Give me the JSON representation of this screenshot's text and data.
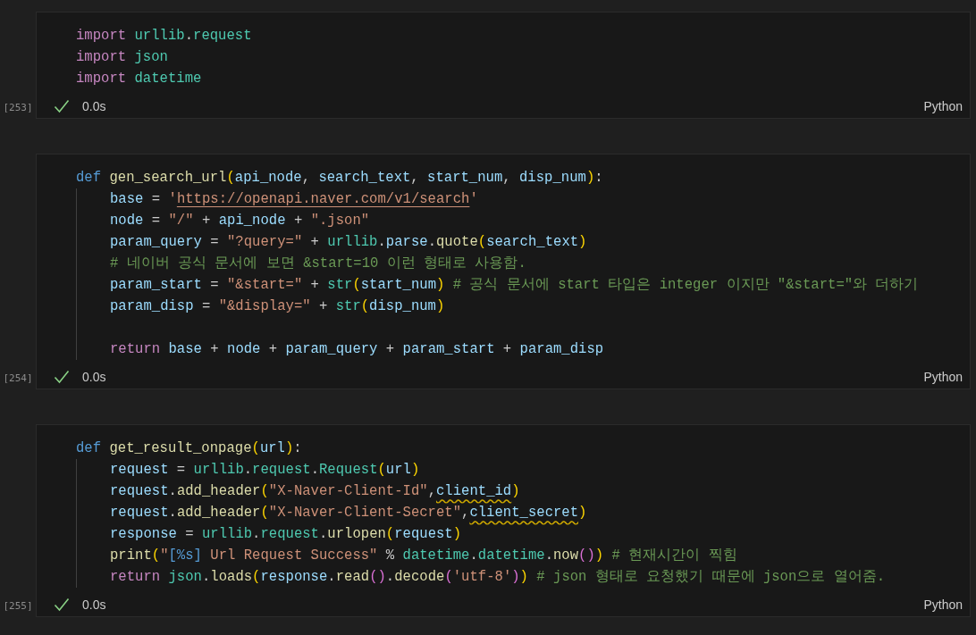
{
  "cells": [
    {
      "count": "[253]",
      "success": true,
      "duration": "0.0s",
      "language": "Python",
      "lines": [
        {
          "kind": "code",
          "tokens": [
            {
              "kind": "keyword",
              "text": "import"
            },
            {
              "kind": "module",
              "text": " urllib"
            },
            {
              "kind": "operator",
              "text": "."
            },
            {
              "kind": "module",
              "text": "request"
            }
          ]
        },
        {
          "kind": "code",
          "tokens": [
            {
              "kind": "keyword",
              "text": "import"
            },
            {
              "kind": "module",
              "text": " json"
            }
          ]
        },
        {
          "kind": "code",
          "tokens": [
            {
              "kind": "keyword",
              "text": "import"
            },
            {
              "kind": "module",
              "text": " datetime"
            }
          ]
        }
      ]
    },
    {
      "count": "[254]",
      "success": true,
      "duration": "0.0s",
      "language": "Python",
      "lines": [
        {
          "kind": "code",
          "tokens": [
            {
              "kind": "def",
              "text": "def"
            },
            {
              "kind": "function",
              "text": " gen_search_url"
            },
            {
              "kind": "bracket",
              "text": "("
            },
            {
              "kind": "variable",
              "text": "api_node"
            },
            {
              "kind": "operator",
              "text": ", "
            },
            {
              "kind": "variable",
              "text": "search_text"
            },
            {
              "kind": "operator",
              "text": ", "
            },
            {
              "kind": "variable",
              "text": "start_num"
            },
            {
              "kind": "operator",
              "text": ", "
            },
            {
              "kind": "variable",
              "text": "disp_num"
            },
            {
              "kind": "bracket",
              "text": ")"
            },
            {
              "kind": "operator",
              "text": ":"
            }
          ],
          "children": [
            {
              "kind": "code",
              "tokens": [
                {
                  "kind": "variable",
                  "text": "base"
                },
                {
                  "kind": "operator",
                  "text": " = "
                },
                {
                  "kind": "string",
                  "text": "'"
                },
                {
                  "kind": "link",
                  "text": "https://openapi.naver.com/v1/search"
                },
                {
                  "kind": "string",
                  "text": "'"
                }
              ]
            },
            {
              "kind": "code",
              "tokens": [
                {
                  "kind": "variable",
                  "text": "node"
                },
                {
                  "kind": "operator",
                  "text": " = "
                },
                {
                  "kind": "string",
                  "text": "\"/\""
                },
                {
                  "kind": "operator",
                  "text": " + "
                },
                {
                  "kind": "variable",
                  "text": "api_node"
                },
                {
                  "kind": "operator",
                  "text": " + "
                },
                {
                  "kind": "string",
                  "text": "\".json\""
                }
              ]
            },
            {
              "kind": "code",
              "tokens": [
                {
                  "kind": "variable",
                  "text": "param_query"
                },
                {
                  "kind": "operator",
                  "text": " = "
                },
                {
                  "kind": "string",
                  "text": "\"?query=\""
                },
                {
                  "kind": "operator",
                  "text": " + "
                },
                {
                  "kind": "module",
                  "text": "urllib"
                },
                {
                  "kind": "operator",
                  "text": "."
                },
                {
                  "kind": "variable",
                  "text": "parse"
                },
                {
                  "kind": "operator",
                  "text": "."
                },
                {
                  "kind": "function",
                  "text": "quote"
                },
                {
                  "kind": "bracket",
                  "text": "("
                },
                {
                  "kind": "variable",
                  "text": "search_text"
                },
                {
                  "kind": "bracket",
                  "text": ")"
                }
              ]
            },
            {
              "kind": "code",
              "tokens": [
                {
                  "kind": "comment",
                  "text": "# 네이버 공식 문서에 보면 &start=10 이런 형태로 사용함."
                }
              ]
            },
            {
              "kind": "code",
              "tokens": [
                {
                  "kind": "variable",
                  "text": "param_start"
                },
                {
                  "kind": "operator",
                  "text": " = "
                },
                {
                  "kind": "string",
                  "text": "\"&start=\""
                },
                {
                  "kind": "operator",
                  "text": " + "
                },
                {
                  "kind": "module",
                  "text": "str"
                },
                {
                  "kind": "bracket",
                  "text": "("
                },
                {
                  "kind": "variable",
                  "text": "start_num"
                },
                {
                  "kind": "bracket",
                  "text": ")"
                },
                {
                  "kind": "comment",
                  "text": " # 공식 문서에 start 타입은 integer 이지만 \"&start=\"와 더하기"
                }
              ]
            },
            {
              "kind": "code",
              "tokens": [
                {
                  "kind": "variable",
                  "text": "param_disp"
                },
                {
                  "kind": "operator",
                  "text": " = "
                },
                {
                  "kind": "string",
                  "text": "\"&display=\""
                },
                {
                  "kind": "operator",
                  "text": " + "
                },
                {
                  "kind": "module",
                  "text": "str"
                },
                {
                  "kind": "bracket",
                  "text": "("
                },
                {
                  "kind": "variable",
                  "text": "disp_num"
                },
                {
                  "kind": "bracket",
                  "text": ")"
                }
              ]
            },
            {
              "kind": "blank"
            },
            {
              "kind": "code",
              "tokens": [
                {
                  "kind": "keyword",
                  "text": "return"
                },
                {
                  "kind": "variable",
                  "text": " base"
                },
                {
                  "kind": "operator",
                  "text": " + "
                },
                {
                  "kind": "variable",
                  "text": "node"
                },
                {
                  "kind": "operator",
                  "text": " + "
                },
                {
                  "kind": "variable",
                  "text": "param_query"
                },
                {
                  "kind": "operator",
                  "text": " + "
                },
                {
                  "kind": "variable",
                  "text": "param_start"
                },
                {
                  "kind": "operator",
                  "text": " + "
                },
                {
                  "kind": "variable",
                  "text": "param_disp"
                }
              ]
            }
          ]
        }
      ]
    },
    {
      "count": "[255]",
      "success": true,
      "duration": "0.0s",
      "language": "Python",
      "lines": [
        {
          "kind": "code",
          "tokens": [
            {
              "kind": "def",
              "text": "def"
            },
            {
              "kind": "function",
              "text": " get_result_onpage"
            },
            {
              "kind": "bracket",
              "text": "("
            },
            {
              "kind": "variable",
              "text": "url"
            },
            {
              "kind": "bracket",
              "text": ")"
            },
            {
              "kind": "operator",
              "text": ":"
            }
          ],
          "children": [
            {
              "kind": "code",
              "tokens": [
                {
                  "kind": "variable",
                  "text": "request"
                },
                {
                  "kind": "operator",
                  "text": " = "
                },
                {
                  "kind": "module",
                  "text": "urllib"
                },
                {
                  "kind": "operator",
                  "text": "."
                },
                {
                  "kind": "module",
                  "text": "request"
                },
                {
                  "kind": "operator",
                  "text": "."
                },
                {
                  "kind": "module",
                  "text": "Request"
                },
                {
                  "kind": "bracket",
                  "text": "("
                },
                {
                  "kind": "variable",
                  "text": "url"
                },
                {
                  "kind": "bracket",
                  "text": ")"
                }
              ]
            },
            {
              "kind": "code",
              "tokens": [
                {
                  "kind": "variable",
                  "text": "request"
                },
                {
                  "kind": "operator",
                  "text": "."
                },
                {
                  "kind": "function",
                  "text": "add_header"
                },
                {
                  "kind": "bracket",
                  "text": "("
                },
                {
                  "kind": "string",
                  "text": "\"X-Naver-Client-Id\""
                },
                {
                  "kind": "operator",
                  "text": ","
                },
                {
                  "kind": "warning",
                  "text": "client_id"
                },
                {
                  "kind": "bracket",
                  "text": ")"
                }
              ]
            },
            {
              "kind": "code",
              "tokens": [
                {
                  "kind": "variable",
                  "text": "request"
                },
                {
                  "kind": "operator",
                  "text": "."
                },
                {
                  "kind": "function",
                  "text": "add_header"
                },
                {
                  "kind": "bracket",
                  "text": "("
                },
                {
                  "kind": "string",
                  "text": "\"X-Naver-Client-Secret\""
                },
                {
                  "kind": "operator",
                  "text": ","
                },
                {
                  "kind": "warning",
                  "text": "client_secret"
                },
                {
                  "kind": "bracket",
                  "text": ")"
                }
              ]
            },
            {
              "kind": "code",
              "tokens": [
                {
                  "kind": "variable",
                  "text": "response"
                },
                {
                  "kind": "operator",
                  "text": " = "
                },
                {
                  "kind": "module",
                  "text": "urllib"
                },
                {
                  "kind": "operator",
                  "text": "."
                },
                {
                  "kind": "module",
                  "text": "request"
                },
                {
                  "kind": "operator",
                  "text": "."
                },
                {
                  "kind": "function",
                  "text": "urlopen"
                },
                {
                  "kind": "bracket",
                  "text": "("
                },
                {
                  "kind": "variable",
                  "text": "request"
                },
                {
                  "kind": "bracket",
                  "text": ")"
                }
              ]
            },
            {
              "kind": "code",
              "tokens": [
                {
                  "kind": "function",
                  "text": "print"
                },
                {
                  "kind": "bracket",
                  "text": "("
                },
                {
                  "kind": "string",
                  "text": "\""
                },
                {
                  "kind": "format",
                  "text": "[%s]"
                },
                {
                  "kind": "string",
                  "text": " Url Request Success\""
                },
                {
                  "kind": "operator",
                  "text": " % "
                },
                {
                  "kind": "module",
                  "text": "datetime"
                },
                {
                  "kind": "operator",
                  "text": "."
                },
                {
                  "kind": "module",
                  "text": "datetime"
                },
                {
                  "kind": "operator",
                  "text": "."
                },
                {
                  "kind": "function",
                  "text": "now"
                },
                {
                  "kind": "bracket2",
                  "text": "()"
                },
                {
                  "kind": "bracket",
                  "text": ")"
                },
                {
                  "kind": "comment",
                  "text": " # 현재시간이 찍힘"
                }
              ]
            },
            {
              "kind": "code",
              "tokens": [
                {
                  "kind": "keyword",
                  "text": "return"
                },
                {
                  "kind": "module",
                  "text": " json"
                },
                {
                  "kind": "operator",
                  "text": "."
                },
                {
                  "kind": "function",
                  "text": "loads"
                },
                {
                  "kind": "bracket",
                  "text": "("
                },
                {
                  "kind": "variable",
                  "text": "response"
                },
                {
                  "kind": "operator",
                  "text": "."
                },
                {
                  "kind": "function",
                  "text": "read"
                },
                {
                  "kind": "bracket2",
                  "text": "()"
                },
                {
                  "kind": "operator",
                  "text": "."
                },
                {
                  "kind": "function",
                  "text": "decode"
                },
                {
                  "kind": "bracket2",
                  "text": "("
                },
                {
                  "kind": "string",
                  "text": "'utf-8'"
                },
                {
                  "kind": "bracket2",
                  "text": ")"
                },
                {
                  "kind": "bracket",
                  "text": ")"
                },
                {
                  "kind": "comment",
                  "text": " # json 형태로 요청했기 때문에 json으로 열어줌."
                }
              ]
            }
          ]
        }
      ]
    }
  ]
}
